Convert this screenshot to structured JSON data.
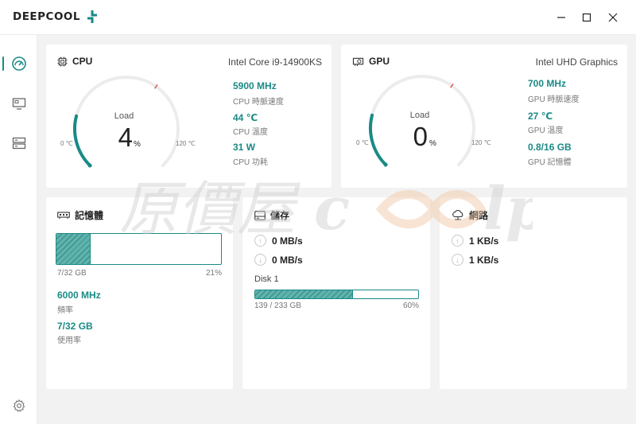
{
  "app": {
    "logo_text": "DEEPCOOL"
  },
  "window": {
    "minimize_icon": "minimize-icon",
    "maximize_icon": "maximize-icon",
    "close_icon": "close-icon"
  },
  "sidebar": {
    "items": [
      {
        "icon": "dashboard-gauge-icon",
        "active": true
      },
      {
        "icon": "monitor-icon",
        "active": false
      },
      {
        "icon": "storage-icon",
        "active": false
      }
    ],
    "settings_icon": "settings-gear-icon"
  },
  "cpu": {
    "title": "CPU",
    "model": "Intel Core i9-14900KS",
    "load_label": "Load",
    "load_value": "4",
    "load_unit": "%",
    "load_fraction": 0.04,
    "min_label": "0 ℃",
    "max_label": "120 ℃",
    "metrics": [
      {
        "value": "5900 MHz",
        "label": "CPU 時脈速度"
      },
      {
        "value": "44 ℃",
        "label": "CPU 溫度"
      },
      {
        "value": "31 W",
        "label": "CPU 功耗"
      }
    ]
  },
  "gpu": {
    "title": "GPU",
    "model": "Intel UHD Graphics",
    "load_label": "Load",
    "load_value": "0",
    "load_unit": "%",
    "load_fraction": 0.0,
    "min_label": "0 ℃",
    "max_label": "120 ℃",
    "metrics": [
      {
        "value": "700 MHz",
        "label": "GPU 時脈速度"
      },
      {
        "value": "27 ℃",
        "label": "GPU 溫度"
      },
      {
        "value": "0.8/16 GB",
        "label": "GPU 記憶體"
      }
    ]
  },
  "memory": {
    "title": "記憶體",
    "usage_text": "7/32 GB",
    "usage_percent": "21%",
    "usage_fraction": 0.21,
    "metrics": [
      {
        "value": "6000 MHz",
        "label": "頻率"
      },
      {
        "value": "7/32 GB",
        "label": "使用率"
      }
    ]
  },
  "storage": {
    "title": "儲存",
    "read": "0 MB/s",
    "write": "0 MB/s",
    "disk_label": "Disk 1",
    "disk_usage": "139 / 233 GB",
    "disk_percent": "60%",
    "disk_fraction": 0.6
  },
  "network": {
    "title": "網路",
    "upload": "1 KB/s",
    "download": "1 KB/s"
  },
  "watermark": {
    "text_cn": "原價屋",
    "text_en": "coolpc"
  },
  "colors": {
    "accent": "#1a8a86",
    "hot_tick": "#e05a5a",
    "background": "#f2f2f2",
    "card": "#ffffff"
  }
}
